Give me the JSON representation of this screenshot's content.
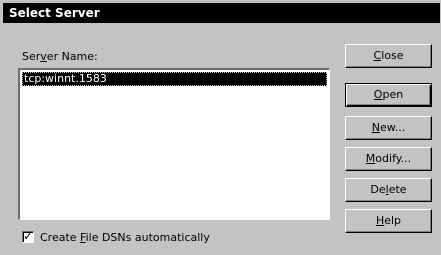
{
  "window": {
    "title": "Select Server"
  },
  "server_name_label": {
    "pre": "Ser",
    "key": "v",
    "post": "er Name:"
  },
  "servers": [
    "tcp:winnt.1583"
  ],
  "checkbox": {
    "checked": true,
    "pre": "Create ",
    "key": "F",
    "post": "ile DSNs automatically"
  },
  "buttons": {
    "close": {
      "pre": "",
      "key": "C",
      "post": "lose"
    },
    "open": {
      "pre": "",
      "key": "O",
      "post": "pen"
    },
    "new": {
      "pre": "",
      "key": "N",
      "post": "ew..."
    },
    "modify": {
      "pre": "",
      "key": "M",
      "post": "odify..."
    },
    "delete": {
      "pre": "De",
      "key": "l",
      "post": "ete"
    },
    "help": {
      "pre": "",
      "key": "H",
      "post": "elp"
    }
  }
}
